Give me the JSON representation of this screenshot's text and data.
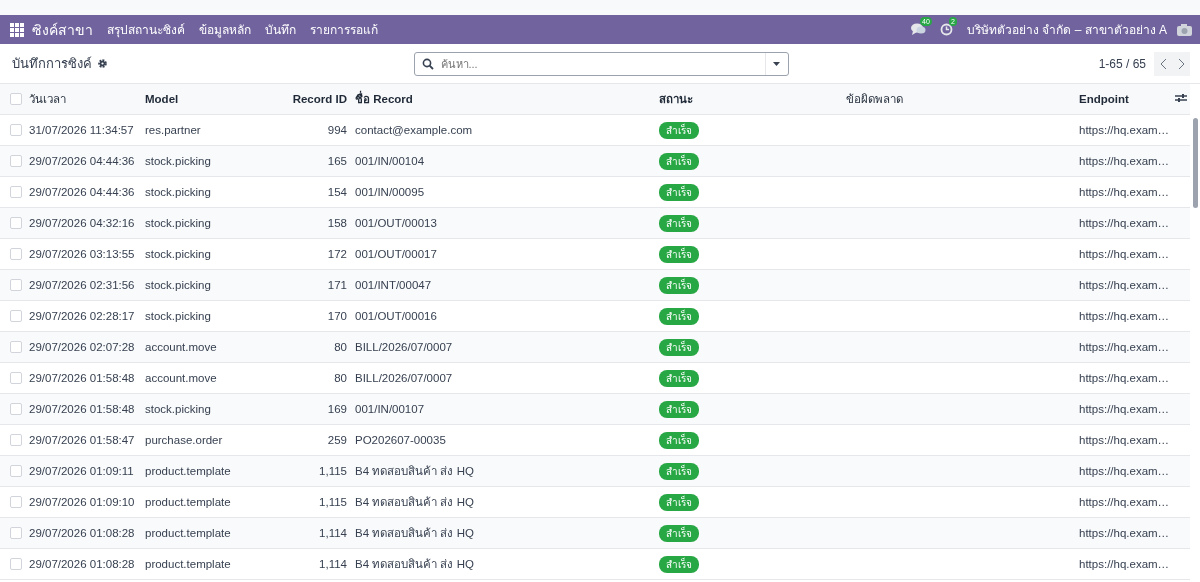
{
  "navbar": {
    "app_name": "ซิงค์สาขา",
    "menu": [
      "สรุปสถานะซิงค์",
      "ข้อมูลหลัก",
      "บันทึก",
      "รายการรอแก้"
    ],
    "messages_count": "40",
    "activities_count": "2",
    "company": "บริษัทตัวอย่าง จำกัด – สาขาตัวอย่าง A"
  },
  "control_panel": {
    "breadcrumb": "บันทึกการซิงค์",
    "search": {
      "placeholder": "ค้นหา..."
    },
    "pager": "1-65 / 65"
  },
  "table": {
    "select_all": {
      "checked": false
    },
    "columns": [
      "วันเวลา",
      "Model",
      "Record ID",
      "ชื่อ Record",
      "สถานะ",
      "ข้อผิดพลาด",
      "Endpoint"
    ],
    "rows": [
      {
        "checked": false,
        "datetime": "31/07/2026 11:34:57",
        "model": "res.partner",
        "record_id": "994",
        "record_name": "contact@example.com",
        "status": "สำเร็จ",
        "endpoint": "https://hq.exam…"
      },
      {
        "checked": false,
        "datetime": "29/07/2026 04:44:36",
        "model": "stock.picking",
        "record_id": "165",
        "record_name": "001/IN/00104",
        "status": "สำเร็จ",
        "endpoint": "https://hq.exam…"
      },
      {
        "checked": false,
        "datetime": "29/07/2026 04:44:36",
        "model": "stock.picking",
        "record_id": "154",
        "record_name": "001/IN/00095",
        "status": "สำเร็จ",
        "endpoint": "https://hq.exam…"
      },
      {
        "checked": false,
        "datetime": "29/07/2026 04:32:16",
        "model": "stock.picking",
        "record_id": "158",
        "record_name": "001/OUT/00013",
        "status": "สำเร็จ",
        "endpoint": "https://hq.exam…"
      },
      {
        "checked": false,
        "datetime": "29/07/2026 03:13:55",
        "model": "stock.picking",
        "record_id": "172",
        "record_name": "001/OUT/00017",
        "status": "สำเร็จ",
        "endpoint": "https://hq.exam…"
      },
      {
        "checked": false,
        "datetime": "29/07/2026 02:31:56",
        "model": "stock.picking",
        "record_id": "171",
        "record_name": "001/INT/00047",
        "status": "สำเร็จ",
        "endpoint": "https://hq.exam…"
      },
      {
        "checked": false,
        "datetime": "29/07/2026 02:28:17",
        "model": "stock.picking",
        "record_id": "170",
        "record_name": "001/OUT/00016",
        "status": "สำเร็จ",
        "endpoint": "https://hq.exam…"
      },
      {
        "checked": false,
        "datetime": "29/07/2026 02:07:28",
        "model": "account.move",
        "record_id": "80",
        "record_name": "BILL/2026/07/0007",
        "status": "สำเร็จ",
        "endpoint": "https://hq.exam…"
      },
      {
        "checked": false,
        "datetime": "29/07/2026 01:58:48",
        "model": "account.move",
        "record_id": "80",
        "record_name": "BILL/2026/07/0007",
        "status": "สำเร็จ",
        "endpoint": "https://hq.exam…"
      },
      {
        "checked": false,
        "datetime": "29/07/2026 01:58:48",
        "model": "stock.picking",
        "record_id": "169",
        "record_name": "001/IN/00107",
        "status": "สำเร็จ",
        "endpoint": "https://hq.exam…"
      },
      {
        "checked": false,
        "datetime": "29/07/2026 01:58:47",
        "model": "purchase.order",
        "record_id": "259",
        "record_name": "PO202607-00035",
        "status": "สำเร็จ",
        "endpoint": "https://hq.exam…"
      },
      {
        "checked": false,
        "datetime": "29/07/2026 01:09:11",
        "model": "product.template",
        "record_id": "1,115",
        "record_name": "B4 ทดสอบสินค้า ส่ง HQ",
        "status": "สำเร็จ",
        "endpoint": "https://hq.exam…"
      },
      {
        "checked": false,
        "datetime": "29/07/2026 01:09:10",
        "model": "product.template",
        "record_id": "1,115",
        "record_name": "B4 ทดสอบสินค้า ส่ง HQ",
        "status": "สำเร็จ",
        "endpoint": "https://hq.exam…"
      },
      {
        "checked": false,
        "datetime": "29/07/2026 01:08:28",
        "model": "product.template",
        "record_id": "1,114",
        "record_name": "B4 ทดสอบสินค้า ส่ง HQ",
        "status": "สำเร็จ",
        "endpoint": "https://hq.exam…"
      },
      {
        "checked": false,
        "datetime": "29/07/2026 01:08:28",
        "model": "product.template",
        "record_id": "1,114",
        "record_name": "B4 ทดสอบสินค้า ส่ง HQ",
        "status": "สำเร็จ",
        "endpoint": "https://hq.exam…"
      }
    ]
  }
}
